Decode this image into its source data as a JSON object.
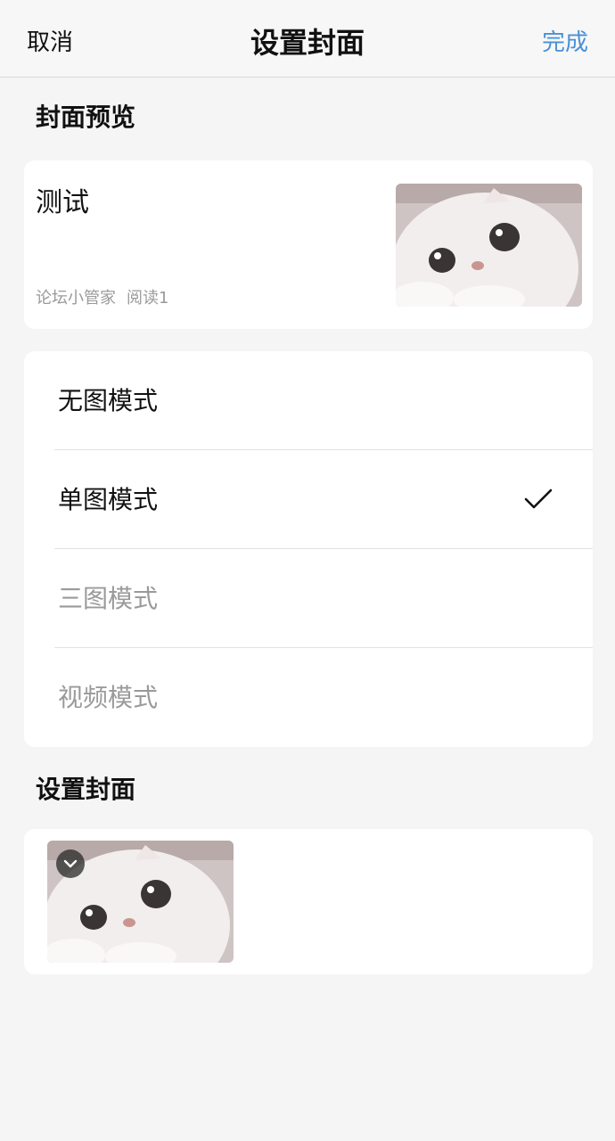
{
  "nav": {
    "cancel": "取消",
    "title": "设置封面",
    "done": "完成",
    "done_color": "#4a90d9"
  },
  "preview": {
    "section_title": "封面预览",
    "post_title": "测试",
    "author": "论坛小管家",
    "reads": "阅读1",
    "thumbnail": "cat-photo"
  },
  "modes": {
    "items": [
      {
        "label": "无图模式",
        "state": "enabled",
        "selected": false
      },
      {
        "label": "单图模式",
        "state": "enabled",
        "selected": true
      },
      {
        "label": "三图模式",
        "state": "disabled",
        "selected": false
      },
      {
        "label": "视频模式",
        "state": "disabled",
        "selected": false
      }
    ],
    "check_icon": "checkmark-icon"
  },
  "cover": {
    "section_title": "设置封面",
    "images": [
      {
        "name": "cat-photo",
        "selected": true
      }
    ]
  }
}
